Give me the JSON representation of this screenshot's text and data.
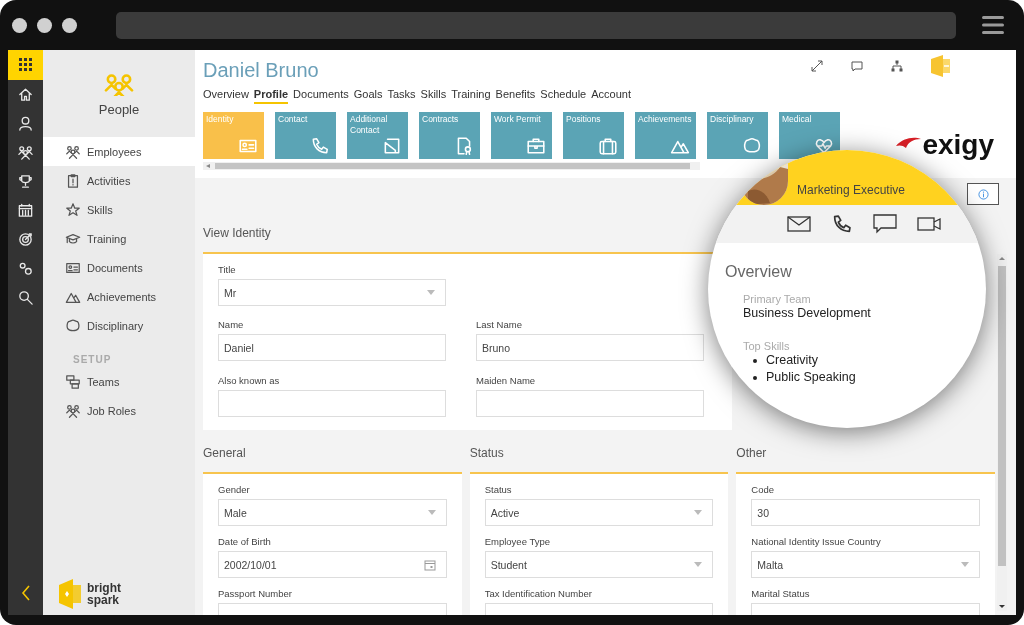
{
  "module": {
    "title": "People"
  },
  "sidebar": {
    "items": [
      {
        "label": "Employees",
        "selected": true
      },
      {
        "label": "Activities",
        "selected": false
      },
      {
        "label": "Skills",
        "selected": false
      },
      {
        "label": "Training",
        "selected": false
      },
      {
        "label": "Documents",
        "selected": false
      },
      {
        "label": "Achievements",
        "selected": false
      },
      {
        "label": "Disciplinary",
        "selected": false
      }
    ],
    "setup_heading": "SETUP",
    "setup_items": [
      {
        "label": "Teams",
        "selected": false
      },
      {
        "label": "Job Roles",
        "selected": false
      }
    ]
  },
  "brand": {
    "line_1": "bright",
    "line_2": "spark"
  },
  "header": {
    "title": "Daniel Bruno",
    "tabs": [
      {
        "label": "Overview",
        "selected": false
      },
      {
        "label": "Profile",
        "selected": true
      },
      {
        "label": "Documents",
        "selected": false
      },
      {
        "label": "Goals",
        "selected": false
      },
      {
        "label": "Tasks",
        "selected": false
      },
      {
        "label": "Skills",
        "selected": false
      },
      {
        "label": "Training",
        "selected": false
      },
      {
        "label": "Benefits",
        "selected": false
      },
      {
        "label": "Schedule",
        "selected": false
      },
      {
        "label": "Account",
        "selected": false
      }
    ]
  },
  "tiles": [
    {
      "label": "Identity",
      "selected": true
    },
    {
      "label": "Contact",
      "selected": false
    },
    {
      "label": "Additional Contact",
      "selected": false
    },
    {
      "label": "Contracts",
      "selected": false
    },
    {
      "label": "Work Permit",
      "selected": false
    },
    {
      "label": "Positions",
      "selected": false
    },
    {
      "label": "Achievements",
      "selected": false
    },
    {
      "label": "Disciplinary",
      "selected": false
    },
    {
      "label": "Medical",
      "selected": false
    }
  ],
  "partner_logo": "exigy",
  "identity": {
    "heading": "View Identity",
    "fields": [
      {
        "label": "Title",
        "value": "Mr",
        "kind": "select"
      },
      {
        "label": "Name",
        "value": "Daniel",
        "kind": "text"
      },
      {
        "label": "Last Name",
        "value": "Bruno",
        "kind": "text"
      },
      {
        "label": "Also known as",
        "kind": "text"
      },
      {
        "label": "Maiden Name",
        "kind": "text"
      }
    ]
  },
  "sections": [
    {
      "heading": "General",
      "fields": [
        {
          "label": "Gender",
          "value": "Male",
          "kind": "select"
        },
        {
          "label": "Date of Birth",
          "value": "2002/10/01",
          "kind": "date"
        },
        {
          "label": "Passport Number",
          "kind": "text"
        }
      ]
    },
    {
      "heading": "Status",
      "fields": [
        {
          "label": "Status",
          "value": "Active",
          "kind": "select"
        },
        {
          "label": "Employee Type",
          "value": "Student",
          "kind": "select"
        },
        {
          "label": "Tax Identification Number",
          "kind": "text"
        }
      ]
    },
    {
      "heading": "Other",
      "fields": [
        {
          "label": "Code",
          "value": "30",
          "kind": "text"
        },
        {
          "label": "National Identity Issue Country",
          "value": "Malta",
          "kind": "select"
        },
        {
          "label": "Marital Status",
          "kind": "text"
        }
      ]
    }
  ],
  "profile_card": {
    "job_title": "Marketing Executive",
    "overview_heading": "Overview",
    "primary_team_label": "Primary Team",
    "primary_team": "Business Development",
    "top_skills_label": "Top Skills",
    "top_skills": [
      "Creativity",
      "Public Speaking"
    ]
  }
}
